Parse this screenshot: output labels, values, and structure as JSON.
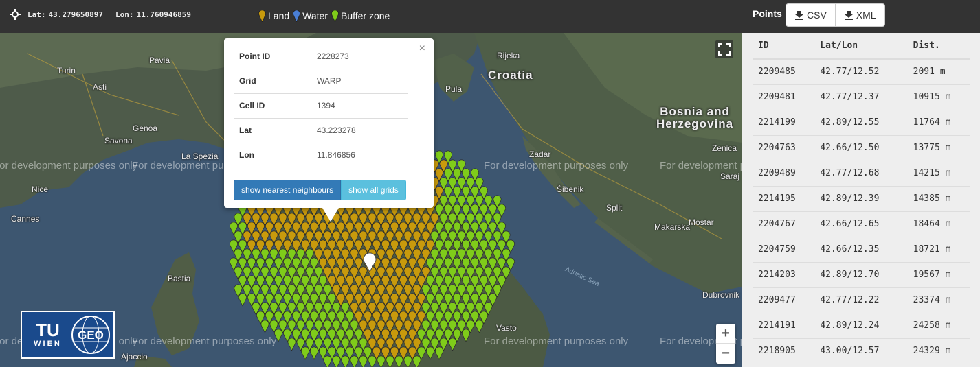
{
  "topbar": {
    "lat_label": "Lat:",
    "lat_value": "43.279650897",
    "lon_label": "Lon:",
    "lon_value": "11.760946859",
    "legend": [
      {
        "label": "Land",
        "color": "#c89a0c"
      },
      {
        "label": "Water",
        "color": "#4a7fd6"
      },
      {
        "label": "Buffer zone",
        "color": "#7fcc1a"
      }
    ],
    "points_label": "Points",
    "csv_label": "CSV",
    "xml_label": "XML"
  },
  "popup": {
    "close_glyph": "×",
    "rows": [
      {
        "key": "Point ID",
        "value": "2228273"
      },
      {
        "key": "Grid",
        "value": "WARP"
      },
      {
        "key": "Cell ID",
        "value": "1394"
      },
      {
        "key": "Lat",
        "value": "43.223278"
      },
      {
        "key": "Lon",
        "value": "11.846856"
      }
    ],
    "btn_neighbours": "show nearest neighbours",
    "btn_all_grids": "show all grids"
  },
  "map": {
    "watermark": "For development purposes only",
    "places": {
      "turin": "Turin",
      "pavia": "Pavia",
      "asti": "Asti",
      "genoa": "Genoa",
      "savona": "Savona",
      "la_spezia": "La Spezia",
      "nice": "Nice",
      "cannes": "Cannes",
      "bastia": "Bastia",
      "ajaccio": "Ajaccio",
      "pula": "Pula",
      "rijeka": "Rijeka",
      "zadar": "Zadar",
      "sibenik": "Šibenik",
      "split": "Split",
      "makarska": "Makarska",
      "mostar": "Mostar",
      "zenica": "Zenica",
      "dubrovnik": "Dubrovnik",
      "vasto": "Vasto",
      "sarajevo": "Saraj"
    },
    "countries": {
      "croatia": "Croatia",
      "bosnia": "Bosnia and\nHerzegovina"
    },
    "sea": "Adriatic Sea",
    "zoom_in": "+",
    "zoom_out": "−",
    "logo_tu": "TU",
    "logo_wien": "WIEN",
    "logo_geo": "GEO"
  },
  "side_table": {
    "headers": [
      "ID",
      "Lat/Lon",
      "Dist."
    ],
    "rows": [
      [
        "2209485",
        "42.77/12.52",
        "2091 m"
      ],
      [
        "2209481",
        "42.77/12.37",
        "10915 m"
      ],
      [
        "2214199",
        "42.89/12.55",
        "11764 m"
      ],
      [
        "2204763",
        "42.66/12.50",
        "13775 m"
      ],
      [
        "2209489",
        "42.77/12.68",
        "14215 m"
      ],
      [
        "2214195",
        "42.89/12.39",
        "14385 m"
      ],
      [
        "2204767",
        "42.66/12.65",
        "18464 m"
      ],
      [
        "2204759",
        "42.66/12.35",
        "18721 m"
      ],
      [
        "2214203",
        "42.89/12.70",
        "19567 m"
      ],
      [
        "2209477",
        "42.77/12.22",
        "23374 m"
      ],
      [
        "2214191",
        "42.89/12.24",
        "24258 m"
      ],
      [
        "2218905",
        "43.00/12.57",
        "24329 m"
      ]
    ]
  }
}
